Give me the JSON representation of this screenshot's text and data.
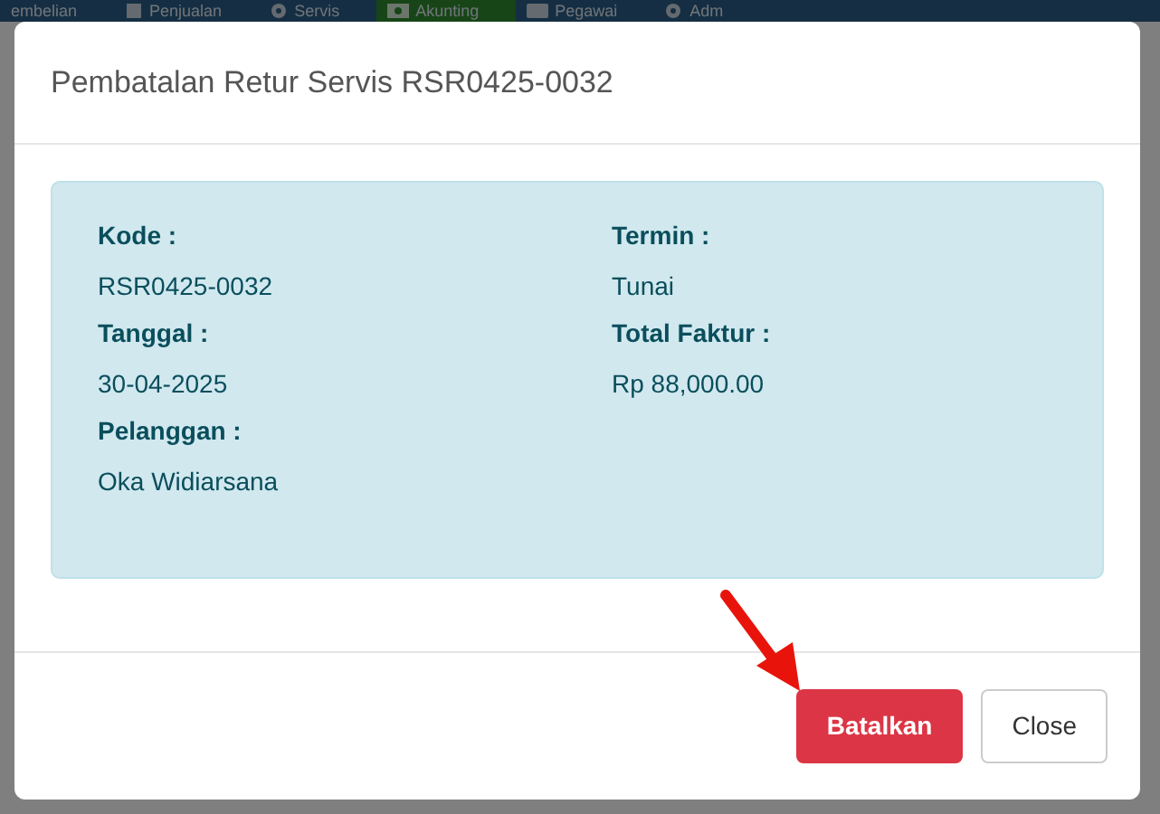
{
  "navbar": {
    "items": [
      {
        "label": "embelian",
        "selected": false
      },
      {
        "label": "Penjualan",
        "selected": false
      },
      {
        "label": "Servis",
        "selected": false
      },
      {
        "label": "Akunting",
        "selected": true
      },
      {
        "label": "Pegawai",
        "selected": false
      },
      {
        "label": "Adm",
        "selected": false
      }
    ]
  },
  "modal": {
    "title": "Pembatalan Retur Servis RSR0425-0032",
    "fields": [
      {
        "label": "Kode :",
        "value": "RSR0425-0032"
      },
      {
        "label": "Termin :",
        "value": "Tunai"
      },
      {
        "label": "Tanggal :",
        "value": "30-04-2025"
      },
      {
        "label": "Total Faktur :",
        "value": "Rp 88,000.00"
      },
      {
        "label": "Pelanggan :",
        "value": "Oka Widiarsana"
      }
    ],
    "buttons": [
      {
        "label": "Batalkan",
        "kind": "danger"
      },
      {
        "label": "Close",
        "kind": "secondary"
      }
    ]
  },
  "annotation": {
    "kind": "arrow"
  }
}
